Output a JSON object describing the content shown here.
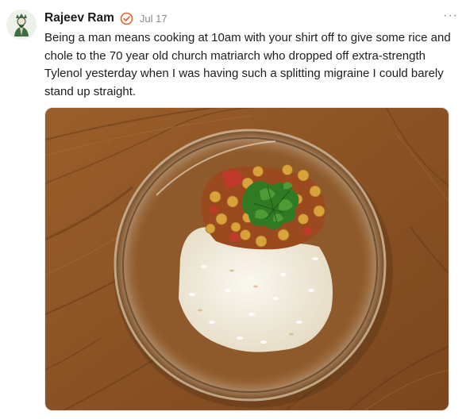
{
  "post": {
    "author": "Rajeev Ram",
    "date": "Jul 17",
    "text": "Being a man means cooking at 10am with your shirt off to give some rice and chole to the 70 year old church matriarch who dropped off extra-strength Tylenol yesterday when I was having such a splitting migraine I could barely stand up straight.",
    "more_label": "···"
  },
  "icons": {
    "avatar": "avatar-illustration",
    "verified": "verified-badge-icon",
    "more": "more-options-icon"
  },
  "colors": {
    "verified_orange": "#e8622c",
    "date_gray": "#8a8a8a",
    "wood": "#8a5426",
    "rice": "#f3efe4",
    "chickpea": "#d9a23b",
    "cilantro": "#2f7a22"
  }
}
